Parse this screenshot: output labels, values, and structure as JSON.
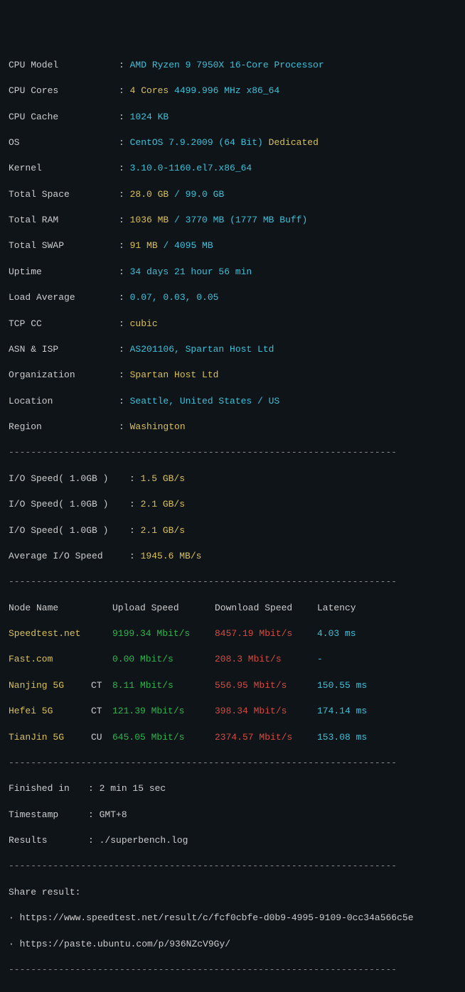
{
  "sysinfo": {
    "cpu_model_label": "CPU Model",
    "cpu_model_value": "AMD Ryzen 9 7950X 16-Core Processor",
    "cpu_cores_label": "CPU Cores",
    "cpu_cores_count": "4 Cores",
    "cpu_cores_freq": "4499.996 MHz x86_64",
    "cpu_cache_label": "CPU Cache",
    "cpu_cache_value": "1024 KB",
    "os_label": "OS",
    "os_value": "CentOS 7.9.2009 (64 Bit)",
    "os_dedicated": "Dedicated",
    "kernel_label": "Kernel",
    "kernel_value": "3.10.0-1160.el7.x86_64",
    "total_space_label": "Total Space",
    "total_space_used": "28.0 GB",
    "total_space_total": "99.0 GB",
    "total_ram_label": "Total RAM",
    "total_ram_used": "1036 MB",
    "total_ram_total": "3770 MB",
    "total_ram_buff": "(1777 MB Buff)",
    "total_swap_label": "Total SWAP",
    "total_swap_used": "91 MB",
    "total_swap_total": "4095 MB",
    "uptime_label": "Uptime",
    "uptime_value": "34 days 21 hour 56 min",
    "load_label": "Load Average",
    "load_value": "0.07, 0.03, 0.05",
    "tcp_label": "TCP CC",
    "tcp_value": "cubic",
    "asn_label": "ASN & ISP",
    "asn_value": "AS201106, Spartan Host Ltd",
    "org_label": "Organization",
    "org_value": "Spartan Host Ltd",
    "location_label": "Location",
    "location_value": "Seattle, United States / US",
    "region_label": "Region",
    "region_value": "Washington"
  },
  "io": {
    "label1": "I/O Speed( 1.0GB )",
    "value1": "1.5 GB/s",
    "label2": "I/O Speed( 1.0GB )",
    "value2": "2.1 GB/s",
    "label3": "I/O Speed( 1.0GB )",
    "value3": "2.1 GB/s",
    "avg_label": "Average I/O Speed",
    "avg_value": "1945.6 MB/s"
  },
  "speed": {
    "header_node": "Node Name",
    "header_upload": "Upload Speed",
    "header_download": "Download Speed",
    "header_latency": "Latency",
    "rows": [
      {
        "node": "Speedtest.net",
        "carrier": "",
        "upload": "9199.34 Mbit/s",
        "download": "8457.19 Mbit/s",
        "latency": "4.03 ms"
      },
      {
        "node": "Fast.com",
        "carrier": "",
        "upload": "0.00 Mbit/s",
        "download": "208.3 Mbit/s",
        "latency": "-"
      },
      {
        "node": "Nanjing 5G",
        "carrier": "CT",
        "upload": "8.11 Mbit/s",
        "download": "556.95 Mbit/s",
        "latency": "150.55 ms"
      },
      {
        "node": "Hefei 5G",
        "carrier": "CT",
        "upload": "121.39 Mbit/s",
        "download": "398.34 Mbit/s",
        "latency": "174.14 ms"
      },
      {
        "node": "TianJin 5G",
        "carrier": "CU",
        "upload": "645.05 Mbit/s",
        "download": "2374.57 Mbit/s",
        "latency": "153.08 ms"
      }
    ]
  },
  "footer": {
    "finished_label": "Finished in",
    "finished_value": "2 min 15 sec",
    "timestamp_label": "Timestamp",
    "timestamp_value": "GMT+8",
    "results_label": "Results",
    "results_value": "./superbench.log",
    "share_label": "Share result:",
    "share_url1": "https://www.speedtest.net/result/c/fcf0cbfe-d0b9-4995-9109-0cc34a566c5e",
    "share_url2": "https://paste.ubuntu.com/p/936NZcV9Gy/"
  },
  "divider": "----------------------------------------------------------------------"
}
